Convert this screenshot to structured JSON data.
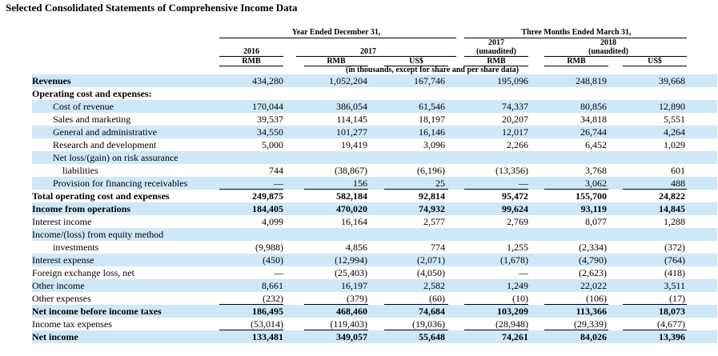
{
  "title": "Selected Consolidated Statements of Comprehensive Income Data",
  "header": {
    "year_ended": "Year Ended December 31,",
    "three_months": "Three Months Ended March 31,",
    "y2016": "2016",
    "y2017": "2017",
    "q2017_year": "2017",
    "q2017_unaudited": "(unaudited)",
    "q2018_year": "2018",
    "q2018_unaudited": "(unaudited)",
    "cur_rmb_2016": "RMB",
    "cur_rmb_2017": "RMB",
    "cur_usd_2017": "US$",
    "cur_rmb_q2017": "RMB",
    "cur_rmb_q2018": "RMB",
    "cur_usd_q2018": "US$",
    "unit_note": "(in thousands, except for share and per share data)"
  },
  "rows": [
    {
      "label": "Revenues",
      "values": [
        "434,280",
        "1,052,204",
        "167,746",
        "195,096",
        "248,819",
        "39,668"
      ]
    },
    {
      "label": "Operating cost and expenses:",
      "values": [
        "",
        "",
        "",
        "",
        "",
        ""
      ]
    },
    {
      "label": "Cost of revenue",
      "values": [
        "170,044",
        "386,054",
        "61,546",
        "74,337",
        "80,856",
        "12,890"
      ]
    },
    {
      "label": "Sales and marketing",
      "values": [
        "39,537",
        "114,145",
        "18,197",
        "20,207",
        "34,818",
        "5,551"
      ]
    },
    {
      "label": "General and administrative",
      "values": [
        "34,550",
        "101,277",
        "16,146",
        "12,017",
        "26,744",
        "4,264"
      ]
    },
    {
      "label": "Research and development",
      "values": [
        "5,000",
        "19,419",
        "3,096",
        "2,266",
        "6,452",
        "1,029"
      ]
    },
    {
      "label": "Net loss/(gain) on risk assurance",
      "values": [
        "",
        "",
        "",
        "",
        "",
        ""
      ]
    },
    {
      "label": "liabilities",
      "values": [
        "744",
        "(38,867)",
        "(6,196)",
        "(13,356)",
        "3,768",
        "601"
      ]
    },
    {
      "label": "Provision for financing receivables",
      "values": [
        "—",
        "156",
        "25",
        "—",
        "3,062",
        "488"
      ]
    },
    {
      "label": "Total operating cost and expenses",
      "values": [
        "249,875",
        "582,184",
        "92,814",
        "95,472",
        "155,700",
        "24,822"
      ]
    },
    {
      "label": "Income from operations",
      "values": [
        "184,405",
        "470,020",
        "74,932",
        "99,624",
        "93,119",
        "14,845"
      ]
    },
    {
      "label": "Interest income",
      "values": [
        "4,099",
        "16,164",
        "2,577",
        "2,769",
        "8,077",
        "1,288"
      ]
    },
    {
      "label": "Income/(loss) from equity method",
      "values": [
        "",
        "",
        "",
        "",
        "",
        ""
      ]
    },
    {
      "label": "investments",
      "values": [
        "(9,988)",
        "4,856",
        "774",
        "1,255",
        "(2,334)",
        "(372)"
      ]
    },
    {
      "label": "Interest expense",
      "values": [
        "(450)",
        "(12,994)",
        "(2,071)",
        "(1,678)",
        "(4,790)",
        "(764)"
      ]
    },
    {
      "label": "Foreign exchange loss, net",
      "values": [
        "—",
        "(25,403)",
        "(4,050)",
        "—",
        "(2,623)",
        "(418)"
      ]
    },
    {
      "label": "Other income",
      "values": [
        "8,661",
        "16,197",
        "2,582",
        "1,249",
        "22,022",
        "3,511"
      ]
    },
    {
      "label": "Other expenses",
      "values": [
        "(232)",
        "(379)",
        "(60)",
        "(10)",
        "(106)",
        "(17)"
      ]
    },
    {
      "label": "Net income before income taxes",
      "values": [
        "186,495",
        "468,460",
        "74,684",
        "103,209",
        "113,366",
        "18,073"
      ]
    },
    {
      "label": "Income tax expenses",
      "values": [
        "(53,014)",
        "(119,403)",
        "(19,036)",
        "(28,948)",
        "(29,339)",
        "(4,677)"
      ]
    },
    {
      "label": "Net income",
      "values": [
        "133,481",
        "349,057",
        "55,648",
        "74,261",
        "84,026",
        "13,396"
      ]
    }
  ]
}
